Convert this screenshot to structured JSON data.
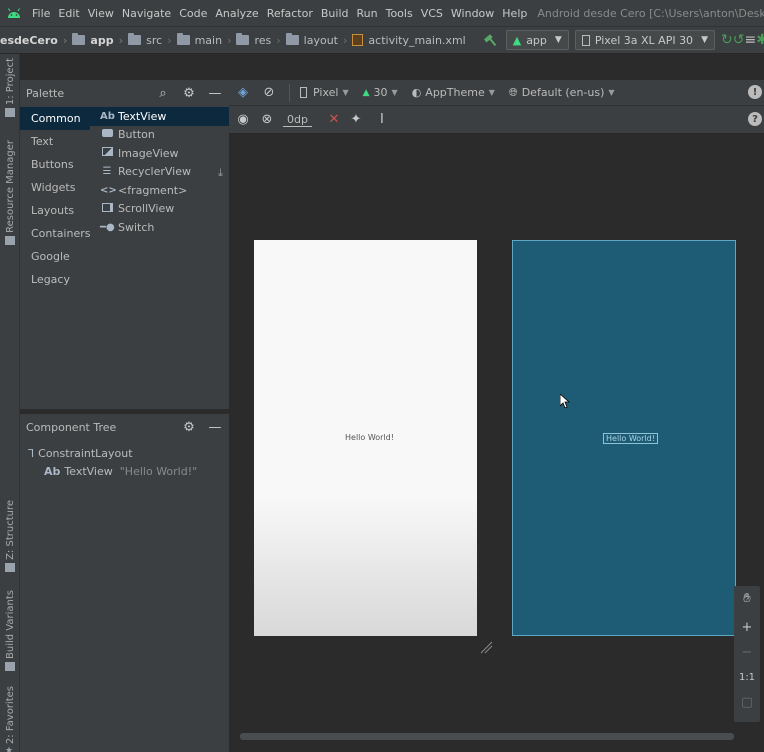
{
  "menu": {
    "items": [
      "File",
      "Edit",
      "View",
      "Navigate",
      "Code",
      "Analyze",
      "Refactor",
      "Build",
      "Run",
      "Tools",
      "VCS",
      "Window",
      "Help"
    ],
    "window_title": "Android desde Cero [C:\\Users\\anton\\Desktop\\Androiddesde"
  },
  "navbar": {
    "project": "esdeCero",
    "crumbs": [
      "app",
      "src",
      "main",
      "res",
      "layout",
      "activity_main.xml"
    ],
    "run_config": "app",
    "device": "Pixel 3a XL API 30"
  },
  "left_strip": {
    "tabs": [
      "1: Project",
      "Resource Manager",
      "Z: Structure",
      "Build Variants",
      "2: Favorites"
    ]
  },
  "palette": {
    "title": "Palette",
    "categories": [
      "Common",
      "Text",
      "Buttons",
      "Widgets",
      "Layouts",
      "Containers",
      "Google",
      "Legacy"
    ],
    "widgets": [
      {
        "icon": "Ab",
        "label": "TextView"
      },
      {
        "icon": "button-icon",
        "label": "Button"
      },
      {
        "icon": "image-icon",
        "label": "ImageView"
      },
      {
        "icon": "list-icon",
        "label": "RecyclerView"
      },
      {
        "icon": "<>",
        "label": "<fragment>"
      },
      {
        "icon": "scroll-icon",
        "label": "ScrollView"
      },
      {
        "icon": "switch-icon",
        "label": "Switch"
      }
    ]
  },
  "component_tree": {
    "title": "Component Tree",
    "root": "ConstraintLayout",
    "child_icon": "Ab",
    "child": "TextView",
    "child_text": "\"Hello World!\""
  },
  "design_toolbar": {
    "device": "Pixel",
    "api": "30",
    "theme": "AppTheme",
    "locale": "Default (en-us)",
    "margin": "0dp"
  },
  "canvas": {
    "design_text": "Hello World!",
    "blueprint_text": "Hello World!"
  },
  "zoom": {
    "one_to_one": "1:1"
  },
  "colors": {
    "accent_green": "#499c54",
    "blueprint": "#1e5c76",
    "selection": "#0d293e"
  }
}
